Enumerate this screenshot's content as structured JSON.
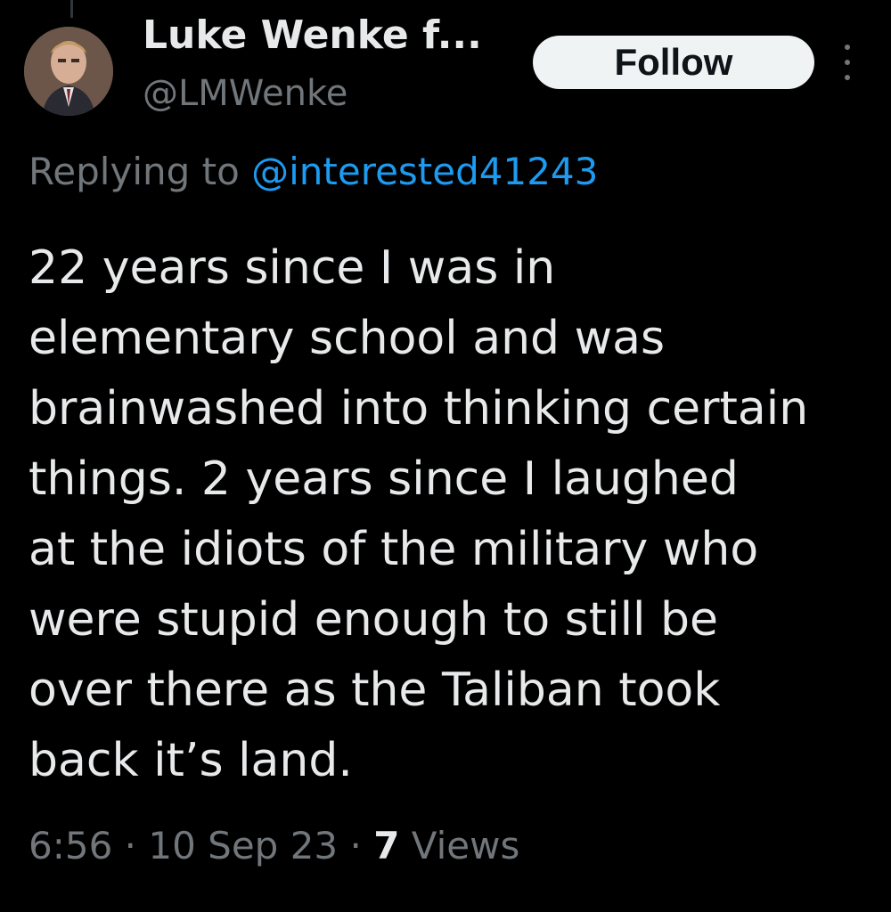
{
  "user": {
    "display_name": "Luke Wenke f...",
    "handle": "@LMWenke"
  },
  "follow_button_label": "Follow",
  "reply": {
    "prefix": "Replying to ",
    "mention": "@interested41243"
  },
  "tweet": {
    "text": "22 years since I was in\nelementary school and was\nbrainwashed into thinking certain\nthings.  2 years since I laughed\nat the idiots of the military who\nwere stupid enough to still be\nover there as the Taliban took\nback it’s land."
  },
  "meta": {
    "time": "6:56",
    "separator": " · ",
    "date": "10 Sep 23",
    "views_count": "7",
    "views_label": " Views"
  },
  "colors": {
    "background": "#000000",
    "text_primary": "#e7e9ea",
    "text_secondary": "#71767b",
    "accent": "#1d9bf0",
    "button_bg": "#eff3f4"
  },
  "icons": {
    "more": "more-vertical-icon"
  }
}
